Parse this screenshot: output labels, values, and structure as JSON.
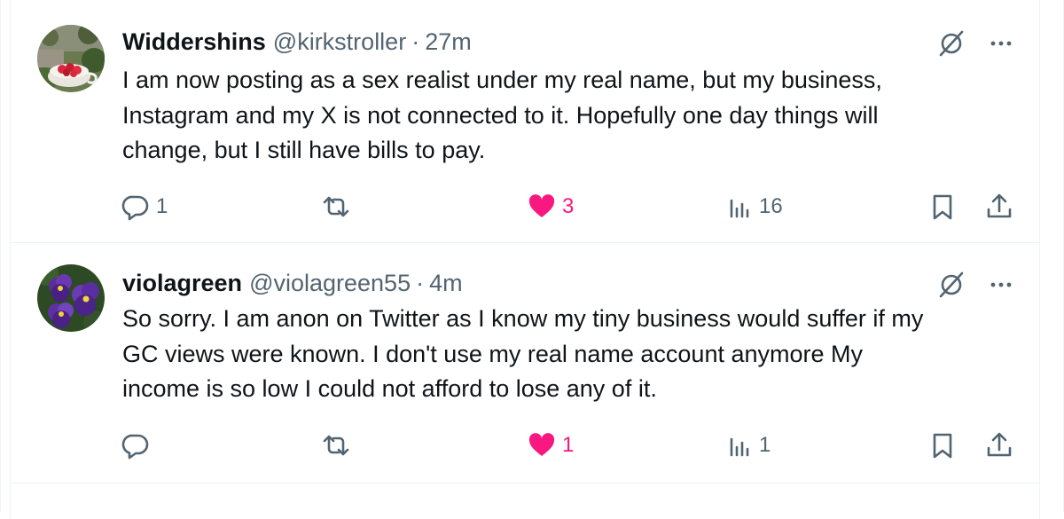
{
  "colors": {
    "text": "#0f1419",
    "secondary": "#536471",
    "like_active": "#f91880",
    "divider": "#eff3f4"
  },
  "tweets": [
    {
      "display_name": "Widdershins",
      "handle": "@kirkstroller",
      "separator": "·",
      "time": "27m",
      "avatar_icon": "strawberry-cup-avatar",
      "body_lines": [
        "I am now posting as a sex realist under my real name, but my business,",
        "Instagram and my X is not connected to it. Hopefully one day things will",
        "change, but I still have bills to pay."
      ],
      "reply_count": "1",
      "retweet_count": "",
      "like_count": "3",
      "liked": true,
      "views": "16"
    },
    {
      "display_name": "violagreen",
      "handle": "@violagreen55",
      "separator": "·",
      "time": "4m",
      "avatar_icon": "pansy-flowers-avatar",
      "body_lines": [
        "So sorry.  I am anon on Twitter as I know my tiny business would suffer if my",
        "GC views were known. I don't use my real name account anymore  My",
        "income is so low I could not afford to lose any of it."
      ],
      "reply_count": "",
      "retweet_count": "",
      "like_count": "1",
      "liked": true,
      "views": "1"
    }
  ]
}
